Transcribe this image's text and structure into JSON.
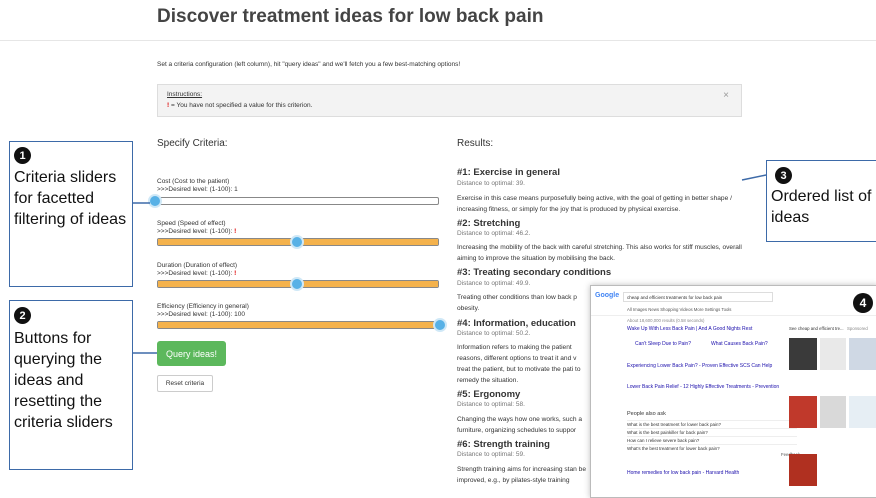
{
  "page": {
    "title": "Discover treatment ideas for low back pain",
    "intro": "Set a criteria configuration (left column), hit \"query ideas\" and we'll fetch you a few best-matching options!"
  },
  "alert": {
    "title": "Instructions:",
    "marker": "!",
    "message": " = You have not specified a value for this criterion.",
    "close": "×"
  },
  "criteria": {
    "heading": "Specify Criteria:",
    "items": [
      {
        "name": "Cost (Cost to the patient)",
        "desired": ">>>Desired level: (1-100): 1",
        "missing": false,
        "value": 1
      },
      {
        "name": "Speed (Speed of effect)",
        "desired": ">>>Desired level: (1-100): ",
        "missing": true,
        "value": 50
      },
      {
        "name": "Duration (Duration of effect)",
        "desired": ">>>Desired level: (1-100): ",
        "missing": true,
        "value": 50
      },
      {
        "name": "Efficiency (Efficiency in general)",
        "desired": ">>>Desired level: (1-100): 100",
        "missing": false,
        "value": 100
      }
    ],
    "query_button": "Query ideas!",
    "reset_button": "Reset criteria"
  },
  "results": {
    "heading": "Results:",
    "items": [
      {
        "title": "#1: Exercise in general",
        "distance": "Distance to optimal: 39.",
        "desc": "Exercise in this case means purposefully being active, with the goal of getting in better shape / increasing fitness, or simply for the joy that is produced by physical exercise."
      },
      {
        "title": "#2: Stretching",
        "distance": "Distance to optimal: 46.2.",
        "desc": "Increasing the mobility of the back with careful stretching. This also works for stiff muscles, overall aiming to improve the situation by mobilising the back."
      },
      {
        "title": "#3: Treating secondary conditions",
        "distance": "Distance to optimal: 49.9.",
        "desc": "Treating other conditions than low back p obesity."
      },
      {
        "title": "#4: Information, education",
        "distance": "Distance to optimal: 50.2.",
        "desc": "Information refers to making the patient reasons, different options to treat it and v treat the patient, but to motivate the pati to remedy the situation."
      },
      {
        "title": "#5: Ergonomy",
        "distance": "Distance to optimal: 58.",
        "desc": "Changing the ways how one works, such a furniture, organizing schedules to suppor"
      },
      {
        "title": "#6: Strength training",
        "distance": "Distance to optimal: 59.",
        "desc": "Strength training aims for increasing stan be improved, e.g., by pilates-style training"
      }
    ]
  },
  "annotations": [
    {
      "num": "1",
      "text": "Criteria sliders for facetted filtering of ideas"
    },
    {
      "num": "2",
      "text": "Buttons for querying the ideas and resetting the criteria sliders"
    },
    {
      "num": "3",
      "text": "Ordered list of ideas"
    },
    {
      "num": "4",
      "text": ""
    }
  ],
  "search_screenshot": {
    "logo": "Google",
    "query": "cheap and efficient treatments for low back pain",
    "tabs": "All    Images    News    Shopping    Videos    More                Settings    Tools",
    "stats": "About 18,600,000 results (0.58 seconds)",
    "ad_title": "Wake Up With Less Back Pain | And A Good Nights Rest",
    "sub1": "Can't Sleep Due to Pain?",
    "sub2": "What Causes Back Pain?",
    "ad2_title": "Experiencing Lower Back Pain? - Proven Effective SCS Can Help",
    "res3_title": "Lower Back Pain Relief - 12 Highly Effective Treatments - Prevention",
    "paa_head": "People also ask",
    "paa": [
      "What is the best treatment for lower back pain?",
      "What is the best painkiller for back pain?",
      "How can I relieve severe back pain?",
      "What's the best treatment for lower back pain?"
    ],
    "feedback": "Feedback",
    "res4_title": "Home remedies for low back pain - Harvard Health",
    "side_head": "See cheap and efficient tre...",
    "sponsored": "Sponsored"
  },
  "colors": {
    "slider_fill": "#f4b24c",
    "slider_knob": "#58b1e6",
    "query_button": "#5cb85c",
    "annotation_border": "#3d6aa8"
  }
}
